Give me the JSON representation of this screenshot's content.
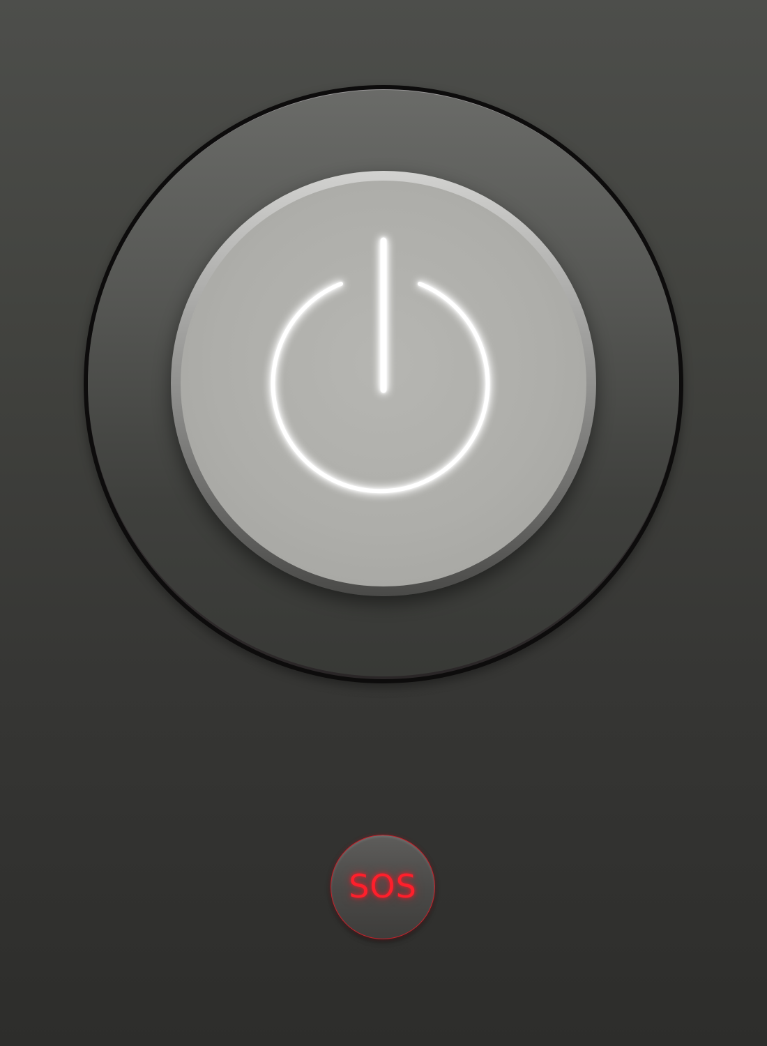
{
  "power": {
    "icon": "power-icon",
    "icon_color": "#ffffff",
    "glow_color": "#ffffff"
  },
  "sos": {
    "label": "SOS",
    "accent_color": "#ff1f2b"
  }
}
